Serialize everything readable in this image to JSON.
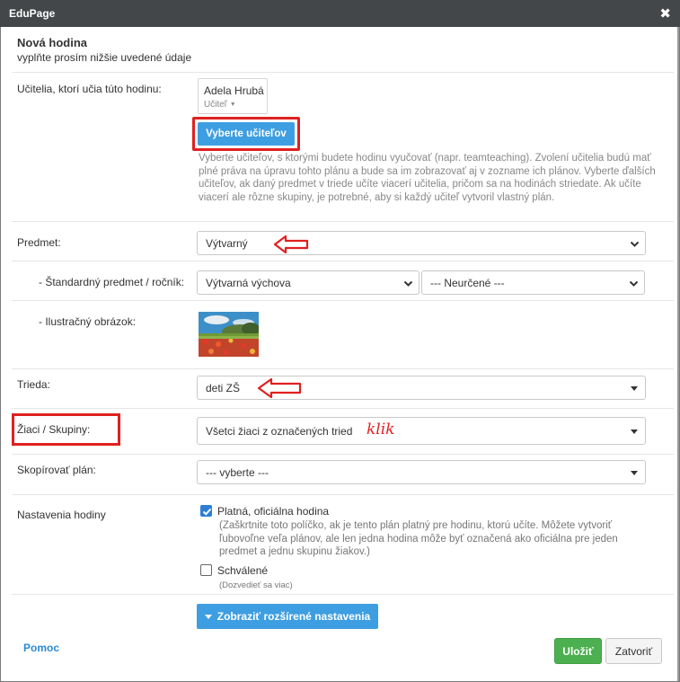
{
  "window": {
    "title": "EduPage",
    "close_glyph": "✖"
  },
  "header": {
    "title": "Nová hodina",
    "subtitle": "vyplňte prosím nižšie uvedené údaje"
  },
  "teachers": {
    "label": "Učitelia, ktorí učia túto hodinu:",
    "card": {
      "name": "Adela Hrubá",
      "role": "Učiteľ"
    },
    "select_button": "Vyberte učiteľov",
    "help": "Vyberte učiteľov, s ktorými budete hodinu vyučovať (napr. teamteaching). Zvolení učitelia budú mať plné práva na úpravu tohto plánu a bude sa im zobrazovať aj v zozname ich plánov. Vyberte ďalších učiteľov, ak daný predmet v triede učíte viacerí učitelia, pričom sa na hodinách striedate. Ak učíte viacerí ale rôzne skupiny, je potrebné, aby si každý učiteľ vytvoril vlastný plán."
  },
  "subject": {
    "label": "Predmet:",
    "value": "Výtvarný"
  },
  "standard_subject": {
    "label": "- Štandardný predmet / ročník:",
    "subject_value": "Výtvarná výchova",
    "grade_value": "--- Neurčené ---"
  },
  "illustration": {
    "label": "- Ilustračný obrázok:"
  },
  "class": {
    "label": "Trieda:",
    "value": "deti ZŠ"
  },
  "students": {
    "label": "Žiaci / Skupiny:",
    "value": "Všetci žiaci z označených tried",
    "annotation": "klik"
  },
  "copy_plan": {
    "label": "Skopírovať plán:",
    "value": "--- vyberte ---"
  },
  "lesson_settings": {
    "label": "Nastavenia hodiny",
    "official": {
      "label": "Platná, oficiálna hodina",
      "checked": true,
      "help": "(Zaškrtnite toto políčko, ak je tento plán platný pre hodinu, ktorú učíte. Môžete vytvoriť ľubovoľne veľa plánov, ale len jedna hodina môže byť označená ako oficiálna pre jeden predmet a jednu skupinu žiakov.)"
    },
    "approved": {
      "label": "Schválené",
      "checked": false,
      "help": "(Dozvedieť sa viac)"
    }
  },
  "advanced_button": "Zobraziť rozšírené nastavenia",
  "footer": {
    "help_link": "Pomoc",
    "save": "Uložiť",
    "close": "Zatvoriť"
  },
  "colors": {
    "titlebar": "#44474a",
    "primary": "#3e9ee2",
    "success": "#4caf50",
    "annotation_red": "#e02020",
    "link": "#2b8ad6"
  }
}
